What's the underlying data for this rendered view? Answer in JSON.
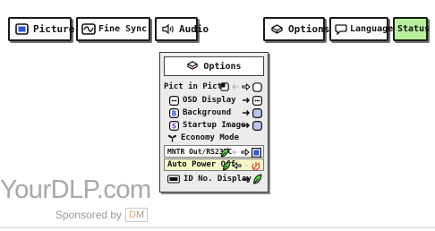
{
  "tabs": {
    "picture": "Picture",
    "fine_sync": "Fine Sync",
    "audio": "Audio",
    "options": "Options",
    "language": "Language",
    "status": "Status"
  },
  "options_menu": {
    "title": "Options",
    "items": [
      {
        "label": "Pict in Pict"
      },
      {
        "label": "OSD Display"
      },
      {
        "label": "Background"
      },
      {
        "label": "Startup Image"
      },
      {
        "label": "Economy Mode"
      },
      {
        "label": "MNTR Out/RS232C"
      },
      {
        "label": "Auto Power Off"
      },
      {
        "label": "ID No. Display"
      }
    ],
    "icon_letters": {
      "background": "B",
      "startup": "S"
    }
  },
  "watermark": {
    "text": "YourDLP.com",
    "sponsored_by": "Sponsored by",
    "sponsor_logo": "DM",
    "sponsor_logo_d": "D",
    "sponsor_logo_m": "M"
  },
  "colors": {
    "status_tab": "#b9f09c",
    "highlight_row": "#f7f7c6",
    "leaf": "#5fd24a",
    "panel_bg": "#ececec"
  }
}
